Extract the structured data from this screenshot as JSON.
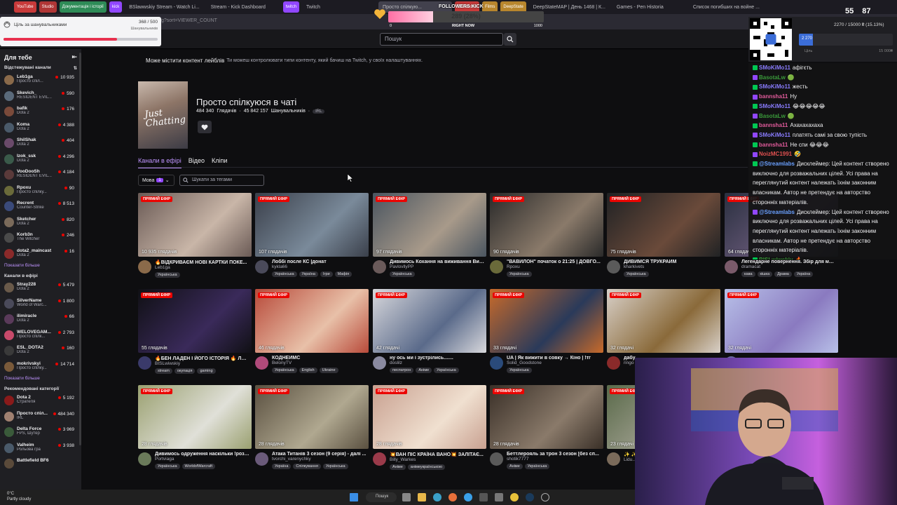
{
  "browser": {
    "tabs": [
      {
        "label": "YouTube",
        "color": "#c83a3a",
        "pill": true
      },
      {
        "label": "Studio",
        "color": "#b03636",
        "pill": true
      },
      {
        "label": "Документація і історії",
        "color": "#2e8b57",
        "pill": true
      },
      {
        "label": "kick",
        "color": "#9147ff",
        "pill": true
      },
      {
        "label": "BSlawwskiy Stream - Watch Li...",
        "color": "",
        "pill": false
      },
      {
        "label": "Stream - Kick Dashboard",
        "color": "",
        "pill": false
      },
      {
        "label": "twitch",
        "color": "#9147ff",
        "pill": true
      },
      {
        "label": "Twitch",
        "color": "",
        "pill": false
      },
      {
        "label": "Просто спілкую...",
        "color": "",
        "pill": false
      },
      {
        "label": "Donations",
        "color": "#c83a3a",
        "pill": true
      },
      {
        "label": "Films",
        "color": "#b8862d",
        "pill": true
      },
      {
        "label": "DeepState",
        "color": "#b8862d",
        "pill": true
      },
      {
        "label": "DeepStateMAP | День 1468 | К...",
        "color": "",
        "pill": false
      },
      {
        "label": "Games - Pen Historia",
        "color": "",
        "pill": false
      },
      {
        "label": "Список погибших на войне ...",
        "color": "",
        "pill": false
      }
    ],
    "url": "g?sort=VIEWER_COUNT"
  },
  "search": {
    "placeholder": "Пошук"
  },
  "sidebar": {
    "for_you": "Для тебе",
    "followed_title": "Відстежувані канали",
    "followed": [
      {
        "name": "Leb1ga",
        "game": "Просто спіл...",
        "viewers": "10 935",
        "color": "#8a6a4a"
      },
      {
        "name": "Skevich_",
        "game": "RESIDENT EVIL...",
        "viewers": "590",
        "color": "#5a6a7a"
      },
      {
        "name": "bafik",
        "game": "Dota 2",
        "viewers": "176",
        "color": "#7a4a3a"
      },
      {
        "name": "Koma",
        "game": "Dota 2",
        "viewers": "4 388",
        "color": "#4a5a6a"
      },
      {
        "name": "ShilShak",
        "game": "Dota 2",
        "viewers": "404",
        "color": "#6a4a6a"
      },
      {
        "name": "Izok_ssk",
        "game": "Dota 2",
        "viewers": "4 296",
        "color": "#3a5a4a"
      },
      {
        "name": "VooDooSh",
        "game": "RESIDENT EVIL...",
        "viewers": "4 184",
        "color": "#5a3a3a"
      },
      {
        "name": "Rpoxu",
        "game": "Просто спілку...",
        "viewers": "90",
        "color": "#6a6a3a"
      },
      {
        "name": "Recrent",
        "game": "Counter-Strike",
        "viewers": "8 513",
        "color": "#3a4a7a"
      },
      {
        "name": "Sketcher",
        "game": "Dota 2",
        "viewers": "820",
        "color": "#7a6a5a"
      },
      {
        "name": "Korb3n",
        "game": "The Witcher",
        "viewers": "246",
        "color": "#4a4a4a"
      },
      {
        "name": "dota2_maincast",
        "game": "Dota 2",
        "viewers": "16",
        "color": "#8a2a2a"
      }
    ],
    "show_more_1": "Показати більше",
    "live_title": "Канали в ефірі",
    "live": [
      {
        "name": "Stray228",
        "game": "Dota 2",
        "viewers": "5 479",
        "color": "#6a5a4a"
      },
      {
        "name": "SilverName",
        "game": "World of Warc...",
        "viewers": "1 800",
        "color": "#4a4a5a"
      },
      {
        "name": "ilimiracle",
        "game": "Dota 2",
        "viewers": "66",
        "color": "#5a3a5a"
      },
      {
        "name": "WELOVEGAM...",
        "game": "Просто спілк...",
        "viewers": "2 793",
        "color": "#c84a6a"
      },
      {
        "name": "ESL_DOTA2",
        "game": "Dota 2",
        "viewers": "160",
        "color": "#3a3a3a"
      },
      {
        "name": "mokrivskyi",
        "game": "Просто спілку...",
        "viewers": "14 714",
        "color": "#7a5a3a"
      }
    ],
    "show_more_2": "Показати більше",
    "rec_title": "Рекомендовані категорії",
    "rec": [
      {
        "name": "Dota 2",
        "game": "Стратегія",
        "viewers": "5 192",
        "color": "#8a1a1a"
      },
      {
        "name": "Просто спіл...",
        "game": "IRL",
        "viewers": "484 340",
        "color": "#a08070"
      },
      {
        "name": "Delta Force",
        "game": "FPS, Шутер",
        "viewers": "3 969",
        "color": "#3a5a3a"
      },
      {
        "name": "Valheim",
        "game": "Рольова гра",
        "viewers": "3 938",
        "color": "#4a5a6a"
      },
      {
        "name": "Battlefield BF6",
        "game": "",
        "viewers": "",
        "color": "#5a4a3a"
      }
    ]
  },
  "notice": {
    "main": "Може містити контент лейблів",
    "sub": "Ти можеш контролювати типи контенту, який бачиш на Twitch, у своїх налаштуваннях."
  },
  "category": {
    "boxart_text": "Just Chatting",
    "title": "Просто спілкуюся в чаті",
    "viewers": "484 340",
    "viewers_label": "Глядачів",
    "followers": "45 842 157",
    "followers_label": "Шанувальників",
    "tag": "IRL"
  },
  "tabs": [
    {
      "label": "Канали в ефірі",
      "active": true
    },
    {
      "label": "Відео",
      "active": false
    },
    {
      "label": "Кліпи",
      "active": false
    }
  ],
  "filters": {
    "lang_label": "Мова",
    "lang_count": "1",
    "tag_placeholder": "Шукати за тегами"
  },
  "live_label": "ПРЯМИЙ ЕФІР",
  "streams": [
    {
      "viewers": "10 935 глядачів",
      "title": "🔥ВІДКРИВАЄМ НОВІ КАРТКИ ПОКЕ...",
      "channel": "Leb1ga",
      "tags": [
        "Українська"
      ],
      "c1": "#6a5a55",
      "c2": "#c9b6a8",
      "av": "#8a6a4a"
    },
    {
      "viewers": "107 глядачів",
      "title": "Лоббі после КС |донат",
      "channel": "kykla66",
      "tags": [
        "Українська",
        "Україна",
        "Ігри",
        "Мафія"
      ],
      "c1": "#3a3f4a",
      "c2": "#7a8a9a",
      "av": "#4a4a5a"
    },
    {
      "viewers": "97 глядачів",
      "title": "Дивимось Кохання на виживання Вип...",
      "channel": "PavlovllyPP",
      "tags": [
        "Українська"
      ],
      "c1": "#4a5560",
      "c2": "#a89a8a",
      "av": "#6a5a5a"
    },
    {
      "viewers": "90 глядачів",
      "title": "\"ВАВИЛОН\" початок о 21:25 | ДОВГО...",
      "channel": "Rpoxu",
      "tags": [
        "Українська"
      ],
      "c1": "#2a2a2a",
      "c2": "#8a7a6a",
      "av": "#6a6a3a"
    },
    {
      "viewers": "75 глядачів",
      "title": "ДИВИМСЯ ТРУКРАЙМ",
      "channel": "kharkivets",
      "tags": [
        "Українська"
      ],
      "c1": "#202224",
      "c2": "#6a4a3a",
      "av": "#5a5a5a"
    },
    {
      "viewers": "64 глядачі",
      "title": "Легендарне повернення. Збір для мог...",
      "channel": "dramacat",
      "tags": [
        "кава",
        "кішка",
        "Драма",
        "Україна"
      ],
      "c1": "#2a3040",
      "c2": "#6a5a7a",
      "av": "#7a5a6a"
    },
    {
      "viewers": "55 глядачів",
      "title": "🔥БЕН ЛАДЕН І ЙОГО ІСТОРІЯ 🔥 ЛЮТ...",
      "channel": "BISLwiwskiy",
      "tags": [
        "stream",
        "окупація",
        "gaming"
      ],
      "c1": "#101014",
      "c2": "#3a2a5a",
      "av": "#3a3a6a"
    },
    {
      "viewers": "46 глядачів",
      "title": "КОДНЕЙМС",
      "channel": "BelonyTV",
      "tags": [
        "Українська",
        "English",
        "Ukraine"
      ],
      "c1": "#b84a3a",
      "c2": "#e8c0a8",
      "av": "#b04a7a"
    },
    {
      "viewers": "42 глядачі",
      "title": "ну ось ми і зустрілись.......",
      "channel": "doslilz",
      "tags": [
        "песпатрон",
        "Аніме",
        "Українська"
      ],
      "c1": "#d8d8dc",
      "c2": "#5a6a8a",
      "av": "#8a8aa0"
    },
    {
      "viewers": "33 глядачі",
      "title": "UA | Як вижити в совку → Кіно | !тг",
      "channel": "Solid_Goodstone",
      "tags": [
        "Українська"
      ],
      "c1": "#c86a2a",
      "c2": "#2a3a5a",
      "av": "#2a4a7a"
    },
    {
      "viewers": "32 глядачі",
      "title": "дабу...",
      "channel": "ringo",
      "tags": [],
      "c1": "#d8d0c8",
      "c2": "#8a6a3a",
      "av": "#8a2a2a"
    },
    {
      "viewers": "32 глядачі",
      "title": "",
      "channel": "",
      "tags": [],
      "c1": "#b8c0e8",
      "c2": "#8a7ac0",
      "av": "#6a6aa0"
    },
    {
      "viewers": "28 глядачів",
      "title": "Дивимось одруження наскільки !розкл...",
      "channel": "Portviaga",
      "tags": [
        "Українська",
        "WorldofWarcraft"
      ],
      "c1": "#9aa070",
      "c2": "#e0e0d8",
      "av": "#6a7a5a"
    },
    {
      "viewers": "28 глядачів",
      "title": "Атака Титанів 3 сезон (9 серія) - далі ...",
      "channel": "tvorchi_varenychky",
      "tags": [
        "Україна",
        "Спілкування",
        "Українська"
      ],
      "c1": "#5a5040",
      "c2": "#b0a890",
      "av": "#6a5a7a"
    },
    {
      "viewers": "28 глядачів",
      "title": "💥ВАН ПІС КРАЇНА ВАНО💥 ЗАЛІТАЄ...",
      "channel": "Billy_Warkes",
      "tags": [
        "Аніме",
        "анімеукраїнською"
      ],
      "c1": "#c8a090",
      "c2": "#f0e0d0",
      "av": "#9a3a4a"
    },
    {
      "viewers": "28 глядачів",
      "title": "Беттлерояль за трон 3 сезон [без сп...",
      "channel": "shotik7777",
      "tags": [
        "Аніме",
        "Українська"
      ],
      "c1": "#3a3028",
      "c2": "#8a7a6a",
      "av": "#5a5a5a"
    },
    {
      "viewers": "23 глядачі",
      "title": "✨ ✨...",
      "channel": "Lidu...",
      "tags": [],
      "c1": "#5a6a4a",
      "c2": "#a0a090",
      "av": "#7a6a5a"
    }
  ],
  "chat": [
    {
      "user": "SMoKiMo11",
      "color": "#8a7cff",
      "text": "афігєть"
    },
    {
      "user": "BasotaLw",
      "color": "#3a9a3a",
      "text": "🟢"
    },
    {
      "user": "SMoKiMo11",
      "color": "#8a7cff",
      "text": "жесть"
    },
    {
      "user": "bannsha11",
      "color": "#e05a9a",
      "text": "Ну"
    },
    {
      "user": "SMoKiMo11",
      "color": "#8a7cff",
      "text": "😂😂😂😂😂"
    },
    {
      "user": "BasotaLw",
      "color": "#3a9a3a",
      "text": "🟢"
    },
    {
      "user": "bannsha11",
      "color": "#e05a9a",
      "text": "Ахахахахаха"
    },
    {
      "user": "SMoKiMo11",
      "color": "#8a7cff",
      "text": "платять самі за свою тупість"
    },
    {
      "user": "bannsha11",
      "color": "#e05a9a",
      "text": "Не спи 😂😂😂"
    },
    {
      "user": "NoizMC1991",
      "color": "#e05050",
      "text": "🤣"
    },
    {
      "user": "@Streamlabs",
      "color": "#6aa0ff",
      "text": "Дисклеймер: Цей контент створено виключно для розважальних цілей. Усі права на переглянутий контент належать їхнім законним власникам. Автор не претендує на авторство сторонніх матеріалів."
    },
    {
      "user": "@Streamlabs",
      "color": "#6aa0ff",
      "text": "Дисклеймер: Цей контент створено виключно для розважальних цілей. Усі права на переглянутий контент належать їхнім законним власникам. Автор не претендує на авторство сторонніх матеріалів."
    },
    {
      "user": "BISLwiwskiy",
      "color": "#3a9a3a",
      "text": "🔥"
    }
  ],
  "goal_overlay": {
    "label": "Ціль за шанувальниками",
    "value": "368 / 500",
    "sub": "Шанувальників",
    "progress": 0.736
  },
  "kick_overlay": {
    "title": "FOLLOWERS KICK",
    "value": "289 (28%)",
    "min": "0",
    "max": "1000",
    "label": "RIGHT NOW",
    "progress": 0.289
  },
  "donat_overlay": {
    "text": "2270 / 15000 ₴ (15.13%)",
    "bar_value": "2 270",
    "min": "Ціль",
    "max": "15 000₴",
    "progress": 0.1513
  },
  "counters": {
    "a": "55",
    "b": "87"
  },
  "taskbar": {
    "temp": "0°C",
    "weather": "Partly cloudy",
    "search": "Пошук"
  }
}
